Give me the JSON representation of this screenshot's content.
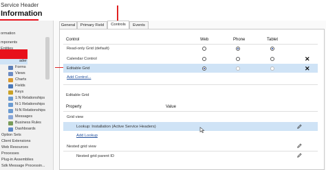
{
  "header": {
    "subtitle": "Service Header",
    "title": "Information"
  },
  "leftnav": {
    "items": [
      {
        "label": "ormation",
        "icon": ""
      },
      {
        "label": "mponents",
        "icon": ""
      },
      {
        "label": "Entities",
        "icon": ""
      },
      {
        "label": "ader",
        "icon": ""
      },
      {
        "label": "Forms",
        "icon": "form-icon"
      },
      {
        "label": "Views",
        "icon": "view-icon"
      },
      {
        "label": "Charts",
        "icon": "chart-icon"
      },
      {
        "label": "Fields",
        "icon": "field-icon"
      },
      {
        "label": "Keys",
        "icon": "key-icon"
      },
      {
        "label": "1:N Relationships",
        "icon": "relationship-icon"
      },
      {
        "label": "N:1 Relationships",
        "icon": "relationship-icon"
      },
      {
        "label": "N:N Relationships",
        "icon": "relationship-icon"
      },
      {
        "label": "Messages",
        "icon": "message-icon"
      },
      {
        "label": "Business Rules",
        "icon": "rule-icon"
      },
      {
        "label": "Dashboards",
        "icon": "dashboard-icon"
      },
      {
        "label": "Option Sets",
        "icon": ""
      },
      {
        "label": "Client Extensions",
        "icon": ""
      },
      {
        "label": "Web Resources",
        "icon": ""
      },
      {
        "label": "Processes",
        "icon": ""
      },
      {
        "label": "Plug-in Assemblies",
        "icon": ""
      },
      {
        "label": "Sdk Message Processin...",
        "icon": ""
      }
    ]
  },
  "tabs": [
    {
      "label": "General"
    },
    {
      "label": "Primary Field"
    },
    {
      "label": "Controls"
    },
    {
      "label": "Events"
    }
  ],
  "controls": {
    "column_headers": {
      "control": "Control",
      "web": "Web",
      "phone": "Phone",
      "tablet": "Tablet"
    },
    "rows": [
      {
        "label": "Read-only Grid (default)",
        "web": false,
        "phone": true,
        "tablet": true,
        "removable": false
      },
      {
        "label": "Calendar Control",
        "web": false,
        "phone": false,
        "tablet": false,
        "removable": true
      },
      {
        "label": "Editable Grid",
        "web": true,
        "phone": false,
        "tablet": false,
        "removable": true
      }
    ],
    "add_control_link": "Add Control..."
  },
  "editable_grid": {
    "section_title": "Editable Grid",
    "property_header": "Property",
    "value_header": "Value",
    "grid_view_label": "Grid view",
    "lookup_row": "Lookup: Installation (Active Service Headers)",
    "add_lookup_link": "Add Lookup",
    "nested_grid_view_label": "Nested grid view",
    "nested_grid_parent_id_label": "Nested grid parent ID"
  },
  "colors": {
    "accent_blue": "#1f4e9c",
    "highlight": "#cfe3f6",
    "redaction": "#e8111c"
  }
}
